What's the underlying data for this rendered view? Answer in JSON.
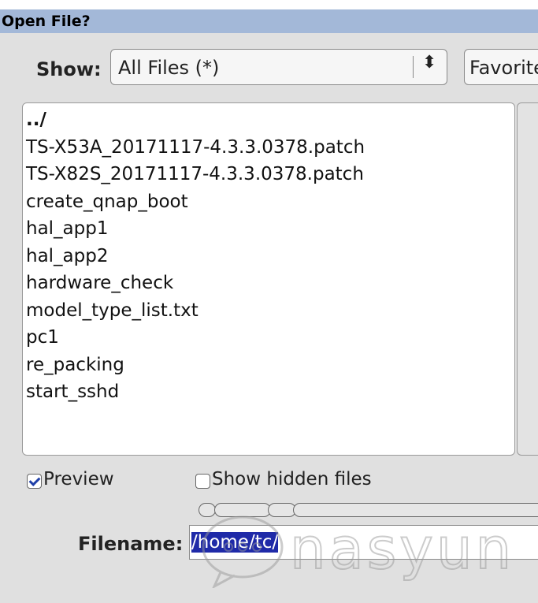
{
  "window": {
    "title": "Open File?"
  },
  "show": {
    "label": "Show:",
    "selected": "All Files (*)",
    "arrows_glyph": "⬍"
  },
  "favorites": {
    "label": "Favorites"
  },
  "file_list": {
    "items": [
      "../",
      "TS-X53A_20171117-4.3.3.0378.patch",
      "TS-X82S_20171117-4.3.3.0378.patch",
      "create_qnap_boot",
      "hal_app1",
      "hal_app2",
      "hardware_check",
      "model_type_list.txt",
      "pc1",
      "re_packing",
      "start_sshd"
    ]
  },
  "options": {
    "preview_label": "Preview",
    "preview_checked": true,
    "hidden_label": "Show hidden files",
    "hidden_checked": false
  },
  "filename": {
    "label": "Filename:",
    "value": "/home/tc/"
  },
  "watermark": {
    "text": "nasyun"
  }
}
